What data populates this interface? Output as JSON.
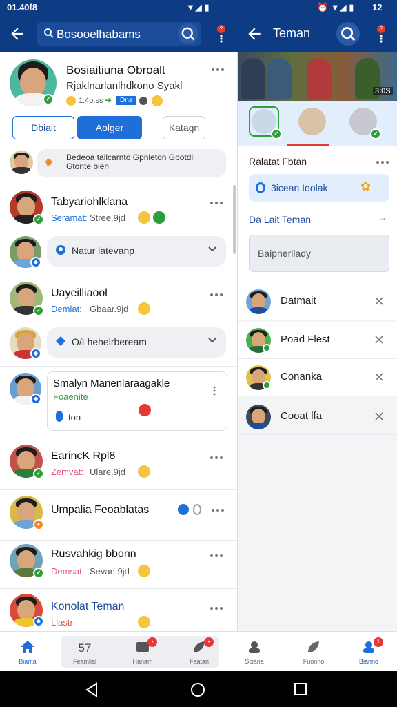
{
  "status_bar": {
    "time_left": "01.40f8",
    "time_right": "12"
  },
  "left_header": {
    "search_text": "Bosooelhabams"
  },
  "right_header": {
    "title": "Teman"
  },
  "profile": {
    "name": "Bosiaitiuna Obroalt",
    "subtitle": "Rjaklnarlanlhdkono Syakl",
    "meta": "1:4o.ss",
    "tag": "Dna",
    "buttons": {
      "first": "Dbiait",
      "second": "Aolger",
      "third": "Katagn"
    }
  },
  "notice": {
    "text": "Bedeoa tallcarnto Gpnleton Gpotdil Gtonte blen"
  },
  "list": [
    {
      "name": "Tabyariohlklana",
      "sub_label": "Seramat:",
      "sub_value": "Stree.9jd"
    },
    {
      "dropdown": "Natur latevanp"
    },
    {
      "name": "Uayeilliaool",
      "sub_label": "Demlat:",
      "sub_value": "Gbaar.9jd"
    },
    {
      "dropdown": "O/Lhehelrbeream"
    },
    {
      "card_title": "Smalyn Manenlaraagakle",
      "card_sub": "Foaenite",
      "card_meta": "ton"
    },
    {
      "name": "EarincK Rpl8",
      "sub_label": "Zemvat:",
      "sub_value": "Ulare.9jd"
    },
    {
      "name": "Umpalia Feoablatas",
      "sub_label": "",
      "sub_value": ""
    },
    {
      "name": "Rusvahkig bbonn",
      "sub_label": "Demsat:",
      "sub_value": "Sevan.9jd"
    },
    {
      "name": "Konolat Teman",
      "sub_label": "Llastr",
      "sub_value": ""
    }
  ],
  "right": {
    "photo_label": "3:0S",
    "section_title": "Ralatat Fbtan",
    "search_chip": "3icean Ioolak",
    "link_label": "Da Lait Teman",
    "input_placeholder": "Baipnerllady",
    "suggestions": [
      "Datmait",
      "Poad Flest",
      "Conanka",
      "Cooat lfa"
    ]
  },
  "bottom_nav": [
    {
      "label": "Biarita"
    },
    {
      "label": "Feamlial",
      "count": "57"
    },
    {
      "label": "Hanam"
    },
    {
      "label": "Faatan"
    },
    {
      "label": "Sciana"
    },
    {
      "label": "Fuonno"
    },
    {
      "label": "Bianno",
      "badge": "1"
    }
  ],
  "colors": {
    "header": "#0d3c85",
    "accent": "#1e6fd9",
    "online": "#2e9d3c",
    "alert": "#e53935"
  }
}
